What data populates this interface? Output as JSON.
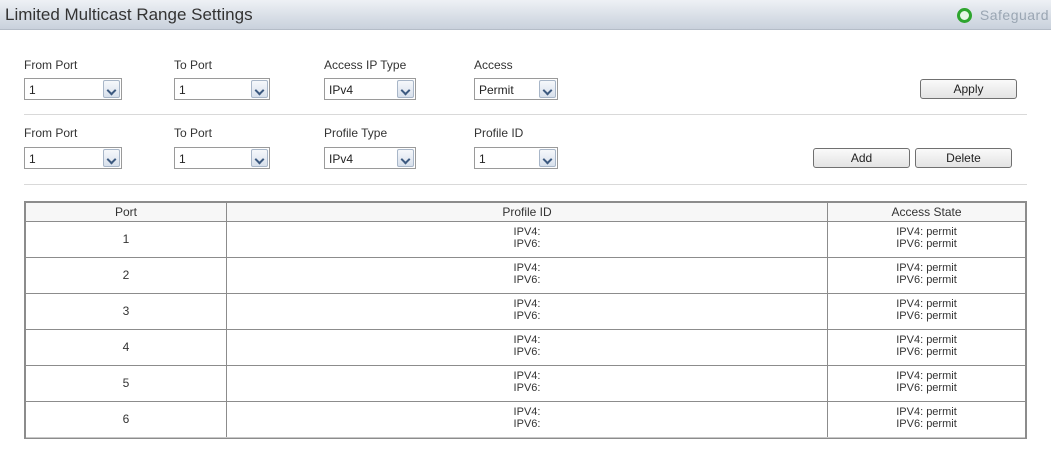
{
  "page": {
    "title": "Limited Multicast Range Settings",
    "safeguard_label": "Safeguard",
    "safeguard_color": "#2ea52e"
  },
  "access_form": {
    "from_port_label": "From Port",
    "from_port_value": "1",
    "to_port_label": "To Port",
    "to_port_value": "1",
    "ip_type_label": "Access IP Type",
    "ip_type_value": "IPv4",
    "access_label": "Access",
    "access_value": "Permit",
    "apply_label": "Apply"
  },
  "profile_form": {
    "from_port_label": "From Port",
    "from_port_value": "1",
    "to_port_label": "To Port",
    "to_port_value": "1",
    "profile_type_label": "Profile Type",
    "profile_type_value": "IPv4",
    "profile_id_label": "Profile ID",
    "profile_id_value": "1",
    "add_label": "Add",
    "delete_label": "Delete"
  },
  "table": {
    "headers": {
      "port": "Port",
      "profile_id": "Profile ID",
      "access_state": "Access State"
    },
    "rows": [
      {
        "port": "1",
        "profile_ipv4": "IPV4:",
        "profile_ipv6": "IPV6:",
        "state_ipv4": "IPV4:  permit",
        "state_ipv6": "IPV6:  permit"
      },
      {
        "port": "2",
        "profile_ipv4": "IPV4:",
        "profile_ipv6": "IPV6:",
        "state_ipv4": "IPV4:  permit",
        "state_ipv6": "IPV6:  permit"
      },
      {
        "port": "3",
        "profile_ipv4": "IPV4:",
        "profile_ipv6": "IPV6:",
        "state_ipv4": "IPV4:  permit",
        "state_ipv6": "IPV6:  permit"
      },
      {
        "port": "4",
        "profile_ipv4": "IPV4:",
        "profile_ipv6": "IPV6:",
        "state_ipv4": "IPV4:  permit",
        "state_ipv6": "IPV6:  permit"
      },
      {
        "port": "5",
        "profile_ipv4": "IPV4:",
        "profile_ipv6": "IPV6:",
        "state_ipv4": "IPV4:  permit",
        "state_ipv6": "IPV6:  permit"
      },
      {
        "port": "6",
        "profile_ipv4": "IPV4:",
        "profile_ipv6": "IPV6:",
        "state_ipv4": "IPV4:  permit",
        "state_ipv6": "IPV6:  permit"
      }
    ]
  }
}
